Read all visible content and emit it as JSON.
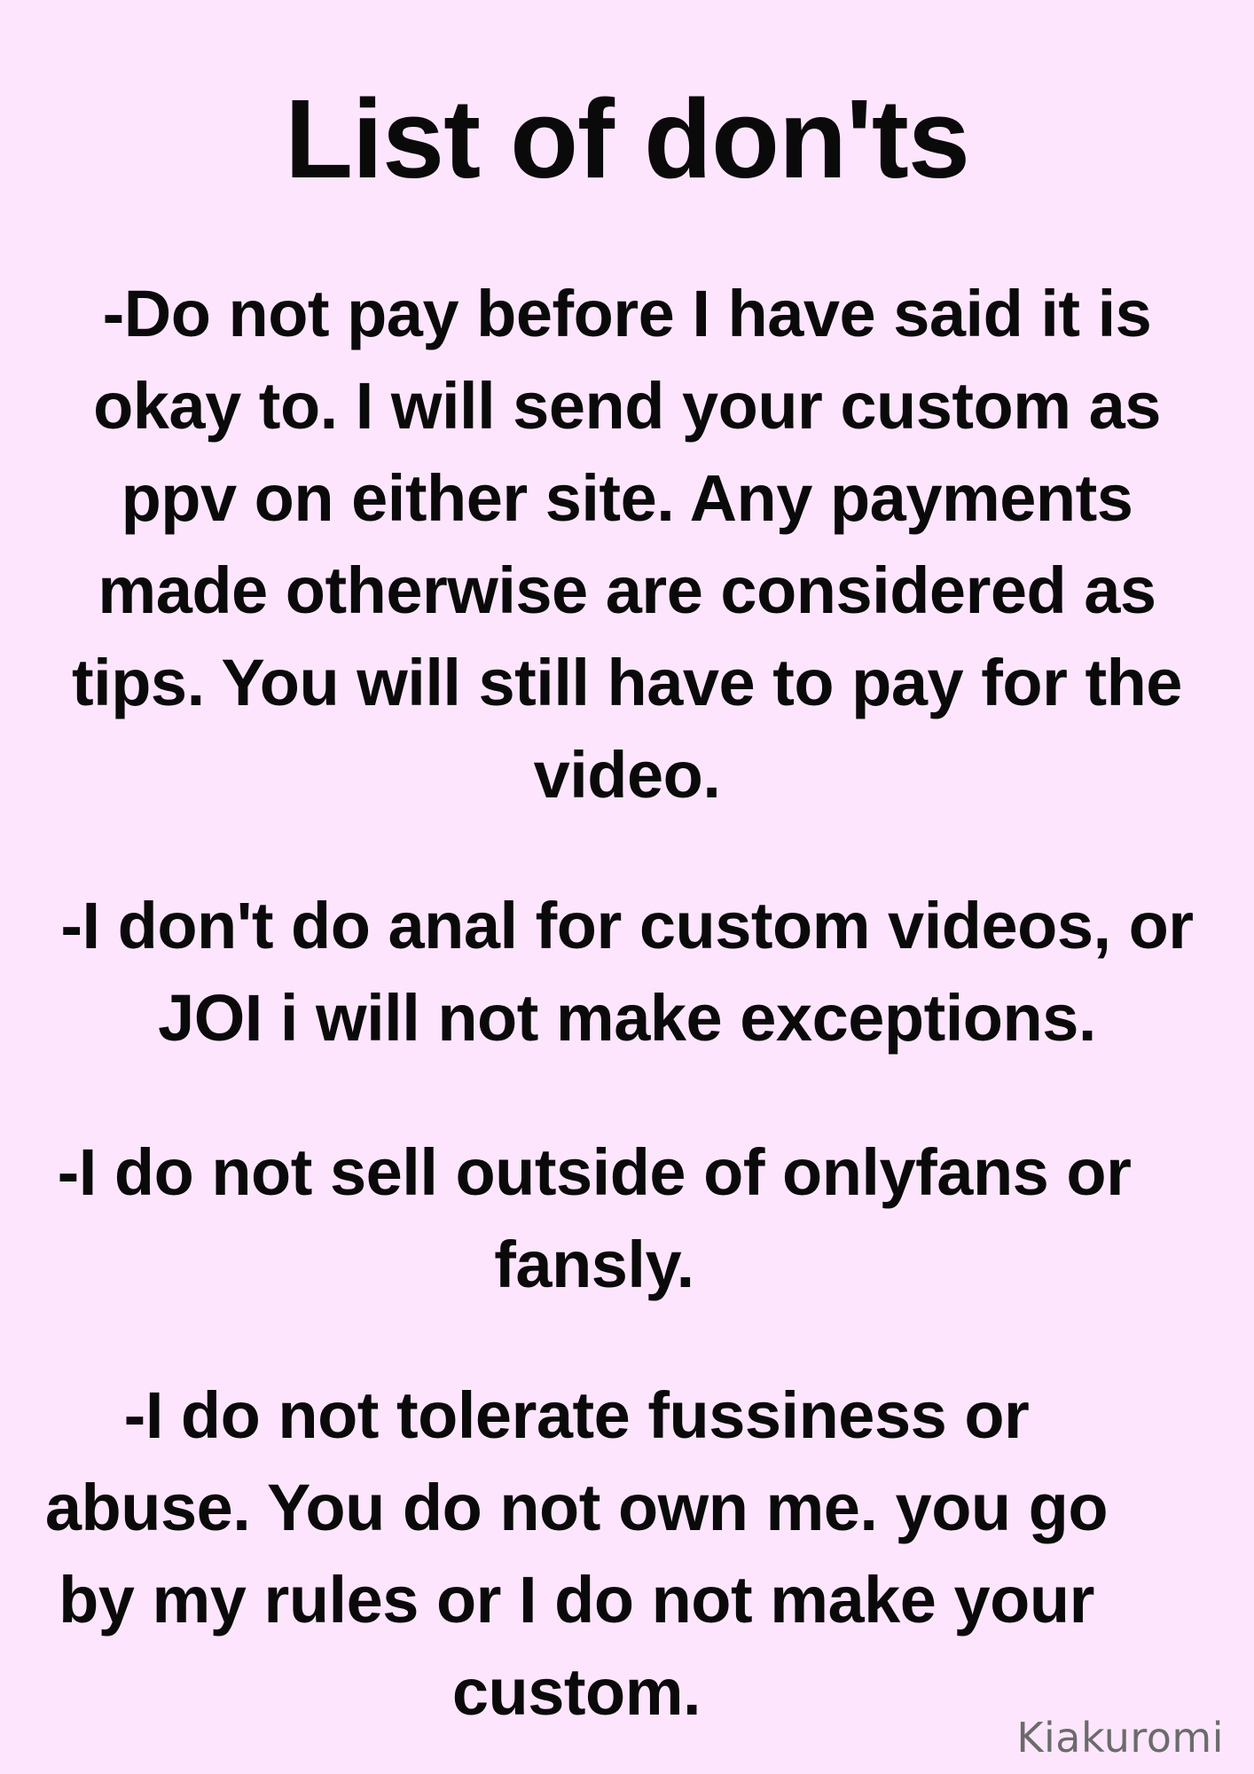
{
  "document": {
    "title": "List of don'ts",
    "rules": [
      {
        "lines": [
          "-Do not pay before I have said it is",
          "okay to. I will send your custom as",
          "ppv on either site. Any payments",
          "made otherwise are considered as",
          "tips. You will still have to pay for the",
          "video."
        ]
      },
      {
        "lines": [
          "-I don't do anal for custom videos, or",
          "JOI i will not make exceptions."
        ]
      },
      {
        "lines": [
          "-I do not sell outside of onlyfans or",
          "fansly."
        ]
      },
      {
        "lines": [
          "-I do not tolerate fussiness or",
          "abuse. You do not own me. you go",
          "by my rules or I do not make your",
          "custom."
        ]
      }
    ],
    "watermark": "Kiakuromi"
  },
  "colors": {
    "background": "#fde6fd",
    "text": "#0a0a0a",
    "watermark": "#6b6b6b"
  }
}
